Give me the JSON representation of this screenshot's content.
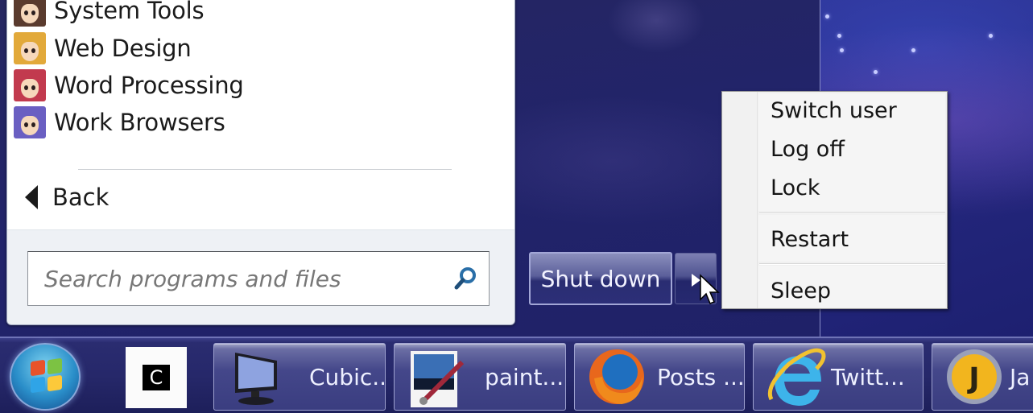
{
  "start_menu": {
    "programs": [
      {
        "label": "System Tools",
        "icon": "avatar-brunette-icon",
        "hair": "#5a3b2e"
      },
      {
        "label": "Web Design",
        "icon": "avatar-blonde-icon",
        "hair": "#e2a93a"
      },
      {
        "label": "Word Processing",
        "icon": "avatar-redhead-icon",
        "hair": "#c23a4e"
      },
      {
        "label": "Work Browsers",
        "icon": "avatar-purple-hair-icon",
        "hair": "#6a5fc2"
      }
    ],
    "back_label": "Back",
    "search": {
      "placeholder": "Search programs and files",
      "value": ""
    },
    "shutdown_label": "Shut down"
  },
  "power_menu": {
    "items": [
      "Switch user",
      "Log off",
      "Lock",
      "Restart",
      "Sleep"
    ]
  },
  "taskbar": {
    "pinned_c_label": "C",
    "tasks": [
      {
        "label": "Cubic...",
        "icon": "monitor-icon"
      },
      {
        "label": "paint....",
        "icon": "paint-net-icon"
      },
      {
        "label": "Posts ...",
        "icon": "firefox-icon"
      },
      {
        "label": "Twitt...",
        "icon": "internet-explorer-icon"
      },
      {
        "label": "Ja",
        "icon": "j-app-icon",
        "icon_letter": "J"
      }
    ]
  },
  "colors": {
    "desktop": "#2b2e8c",
    "menu_bg": "#ffffff",
    "context_menu_bg": "#f0f0f0",
    "taskbar": "#26286a"
  }
}
